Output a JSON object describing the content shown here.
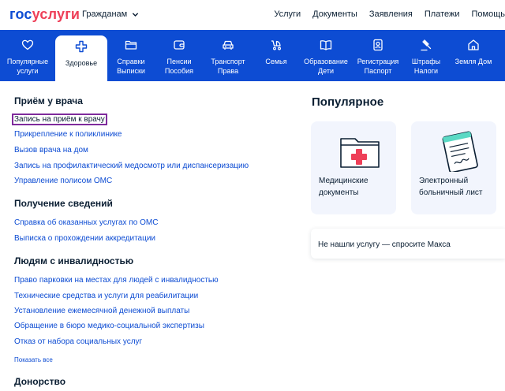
{
  "header": {
    "logo_part1": "гос",
    "logo_part2": "услуги",
    "audience_selector": "Гражданам",
    "nav": [
      "Услуги",
      "Документы",
      "Заявления",
      "Платежи",
      "Помощь"
    ]
  },
  "categories": [
    {
      "label": "Популярные\nуслуги",
      "icon": "heart-icon"
    },
    {
      "label": "Здоровье",
      "icon": "medical-cross-icon",
      "active": true
    },
    {
      "label": "Справки\nВыписки",
      "icon": "folder-icon"
    },
    {
      "label": "Пенсии\nПособия",
      "icon": "wallet-icon"
    },
    {
      "label": "Транспорт\nПрава",
      "icon": "car-icon"
    },
    {
      "label": "Семья",
      "icon": "stroller-icon"
    },
    {
      "label": "Образование\nДети",
      "icon": "book-icon"
    },
    {
      "label": "Регистрация\nПаспорт",
      "icon": "id-card-icon"
    },
    {
      "label": "Штрафы\nНалоги",
      "icon": "gavel-icon"
    },
    {
      "label": "Земля Дом",
      "icon": "house-icon"
    }
  ],
  "sections": {
    "doctor": {
      "title": "Приём у врача",
      "links": [
        "Запись на приём к врачу",
        "Прикрепление к поликлинике",
        "Вызов врача на дом",
        "Запись на профилактический медосмотр или диспансеризацию",
        "Управление полисом ОМС"
      ]
    },
    "info": {
      "title": "Получение сведений",
      "links": [
        "Справка об оказанных услугах по ОМС",
        "Выписка о прохождении аккредитации"
      ]
    },
    "disability": {
      "title": "Людям с инвалидностью",
      "links": [
        "Право парковки на местах для людей с инвалидностью",
        "Технические средства и услуги для реабилитации",
        "Установление ежемесячной денежной выплаты",
        "Обращение в бюро медико-социальной экспертизы",
        "Отказ от набора социальных услуг"
      ],
      "show_all": "Показать все"
    },
    "donor": {
      "title": "Донорство"
    }
  },
  "popular": {
    "title": "Популярное",
    "cards": [
      {
        "label": "Медицинские\nдокументы",
        "icon": "medical-folder-illustration"
      },
      {
        "label": "Электронный\nбольничный лист",
        "icon": "sick-leave-illustration"
      }
    ],
    "ask_max": "Не нашли услугу — спросите Макса"
  },
  "colors": {
    "brand_blue": "#0d4cd3",
    "brand_red": "#ee3f58",
    "text": "#0b1f33",
    "card_bg": "#f2f5fd",
    "focus": "#7f2b9c"
  }
}
